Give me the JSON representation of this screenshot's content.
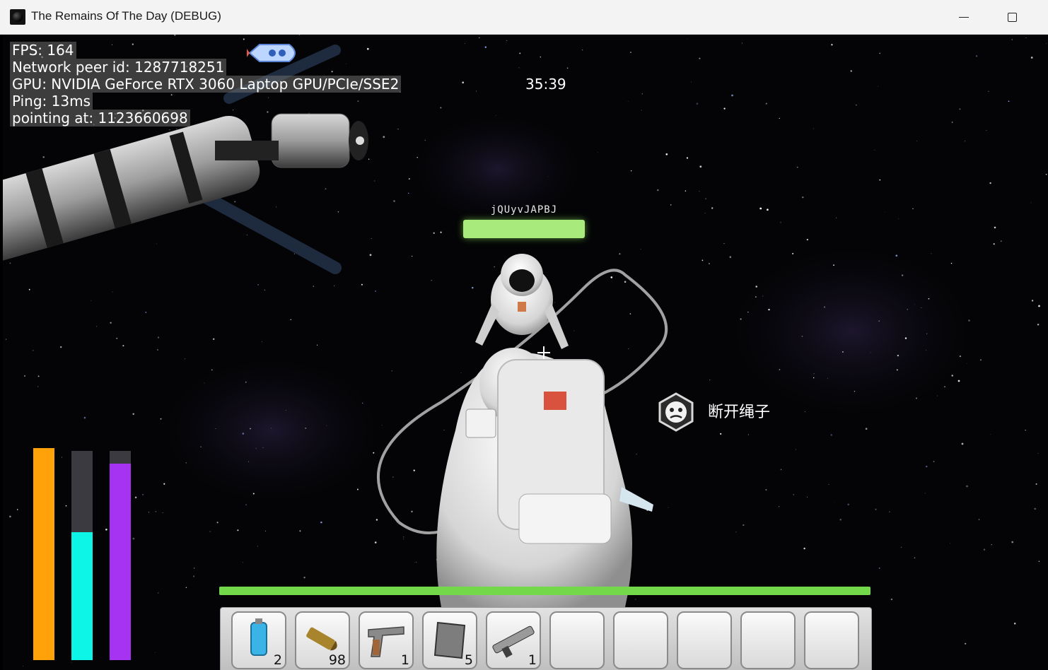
{
  "window": {
    "title": "The Remains Of The Day (DEBUG)"
  },
  "debug": {
    "lines": [
      "FPS: 164",
      "Network peer id: 1287718251",
      "GPU: NVIDIA GeForce RTX 3060 Laptop GPU/PCIe/SSE2",
      "Ping: 13ms",
      "pointing at: 1123660698"
    ]
  },
  "timer": "35:39",
  "player": {
    "name": "jQUyvJAPBJ",
    "health_fraction": 1.0
  },
  "prompt": {
    "icon": "disconnect-rope-icon",
    "label": "断开绳子"
  },
  "stats": [
    {
      "color": "#ffa20a",
      "fraction": 1.0
    },
    {
      "color": "#0cf5e6",
      "fraction": 0.61
    },
    {
      "color": "#a632f2",
      "fraction": 0.94
    }
  ],
  "main_health": {
    "fraction": 1.0,
    "color": "#74d94a"
  },
  "hotbar": {
    "slots": [
      {
        "icon": "oxygen-tank-icon",
        "count": "2"
      },
      {
        "icon": "ammo-bullet-icon",
        "count": "98"
      },
      {
        "icon": "pistol-icon",
        "count": "1"
      },
      {
        "icon": "metal-plate-icon",
        "count": "5"
      },
      {
        "icon": "rifle-icon",
        "count": "1"
      },
      {
        "icon": "",
        "count": ""
      },
      {
        "icon": "",
        "count": ""
      },
      {
        "icon": "",
        "count": ""
      },
      {
        "icon": "",
        "count": ""
      },
      {
        "icon": "",
        "count": ""
      }
    ]
  }
}
